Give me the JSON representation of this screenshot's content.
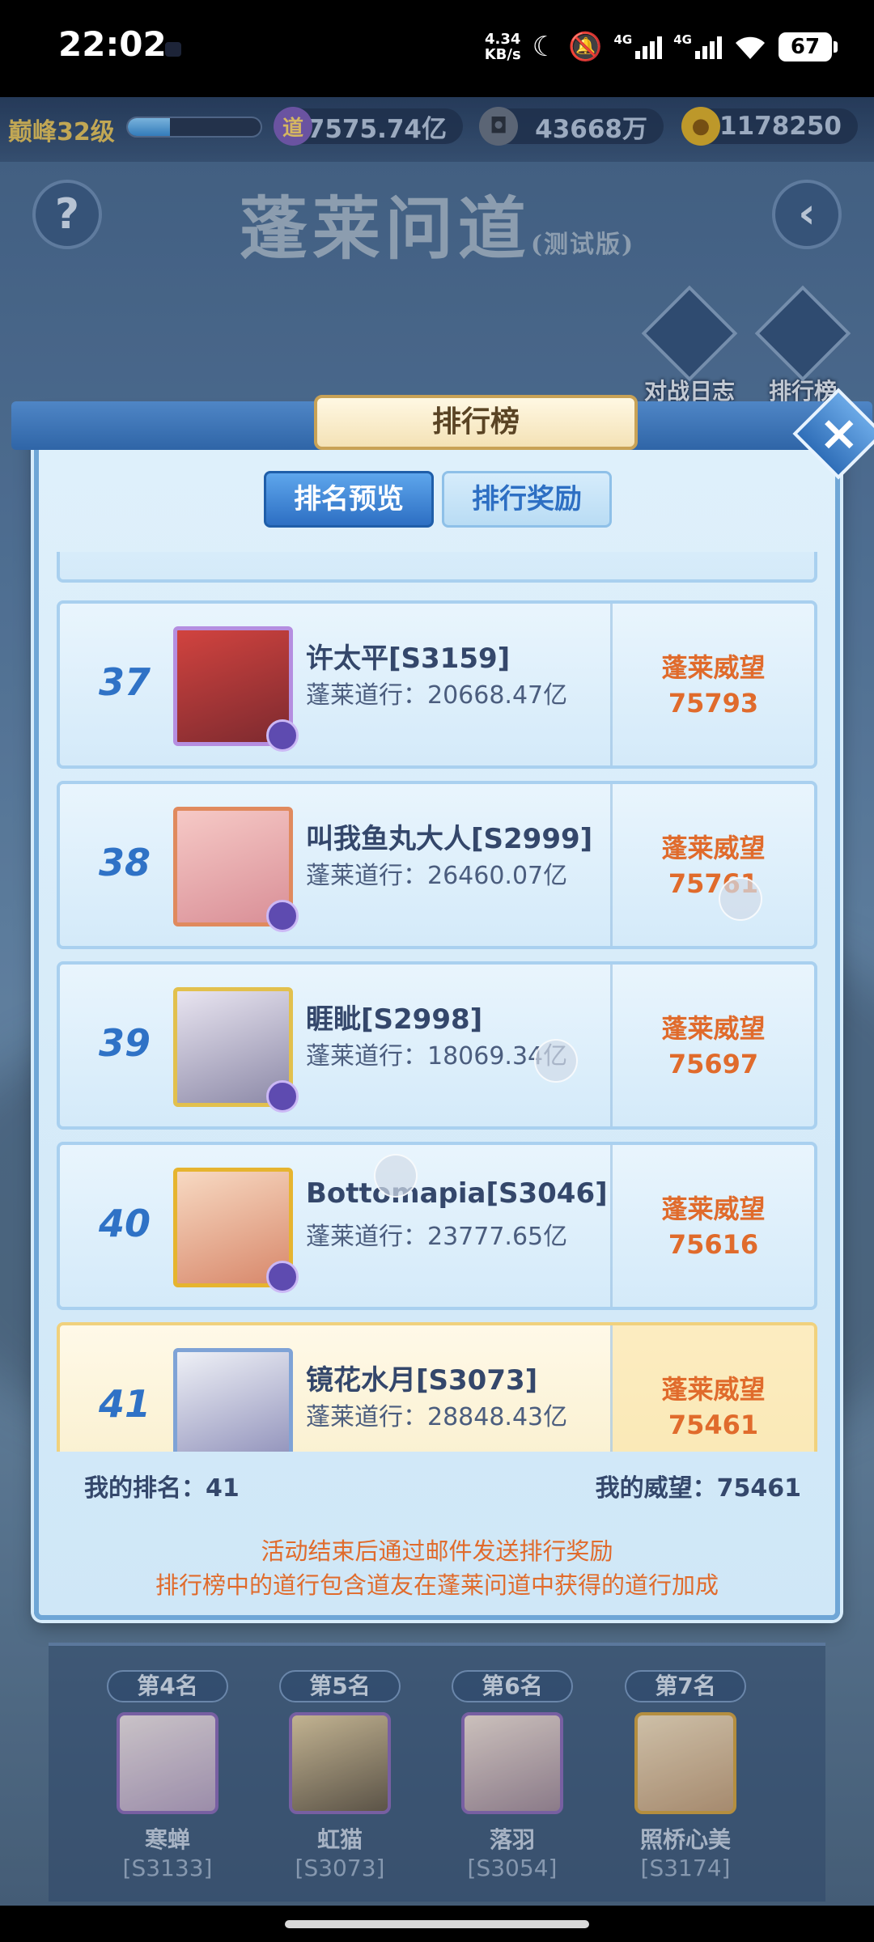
{
  "status": {
    "time": "22:02",
    "speed_value": "4.34",
    "speed_unit": "KB/s",
    "net1": "4G",
    "net2": "4G",
    "battery": "67"
  },
  "hud": {
    "level": "巅峰32级",
    "level_progress": 0.32,
    "res_dao_icon": "道",
    "res_dao": "7575.74亿",
    "res_coin": "43668万",
    "res_gold": "1178250",
    "title": "蓬莱问道",
    "title_suffix": "(测试版)",
    "battle_log": "对战日志",
    "leaderboard": "排行榜"
  },
  "panel": {
    "title": "排行榜",
    "tabs": [
      {
        "label": "排名预览",
        "active": true
      },
      {
        "label": "排行奖励",
        "active": false
      }
    ],
    "rows": [
      {
        "rank": "37",
        "name": "许太平[S3159]",
        "power": "蓬莱道行：20668.47亿",
        "label": "蓬莱威望",
        "score": "75793"
      },
      {
        "rank": "38",
        "name": "叫我鱼丸大人[S2999]",
        "power": "蓬莱道行：26460.07亿",
        "label": "蓬莱威望",
        "score": "75761"
      },
      {
        "rank": "39",
        "name": "睚眦[S2998]",
        "power": "蓬莱道行：18069.34亿",
        "label": "蓬莱威望",
        "score": "75697"
      },
      {
        "rank": "40",
        "name": "Bottomapia[S3046]",
        "power": "蓬莱道行：23777.65亿",
        "label": "蓬莱威望",
        "score": "75616"
      },
      {
        "rank": "41",
        "name": "镜花水月[S3073]",
        "power": "蓬莱道行：28848.43亿",
        "label": "蓬莱威望",
        "score": "75461"
      }
    ],
    "my_rank": "我的排名：41",
    "my_score": "我的威望：75461",
    "note1": "活动结束后通过邮件发送排行奖励",
    "note2": "排行榜中的道行包含道友在蓬莱问道中获得的道行加成"
  },
  "podium": [
    {
      "rank": "第4名",
      "name": "寒蝉",
      "server": "[S3133]"
    },
    {
      "rank": "第5名",
      "name": "虹猫",
      "server": "[S3073]"
    },
    {
      "rank": "第6名",
      "name": "落羽",
      "server": "[S3054]"
    },
    {
      "rank": "第7名",
      "name": "照桥心美",
      "server": "[S3174]"
    }
  ],
  "colors": {
    "accent": "#2f72c6",
    "score": "#e06b2c",
    "highlight": "#f9efcc"
  },
  "icons": [
    "moon-icon",
    "mute-icon",
    "signal-icon",
    "wifi-icon",
    "battery-icon",
    "help-icon",
    "back-icon",
    "close-icon",
    "coin-icon",
    "gold-ingot-icon"
  ]
}
